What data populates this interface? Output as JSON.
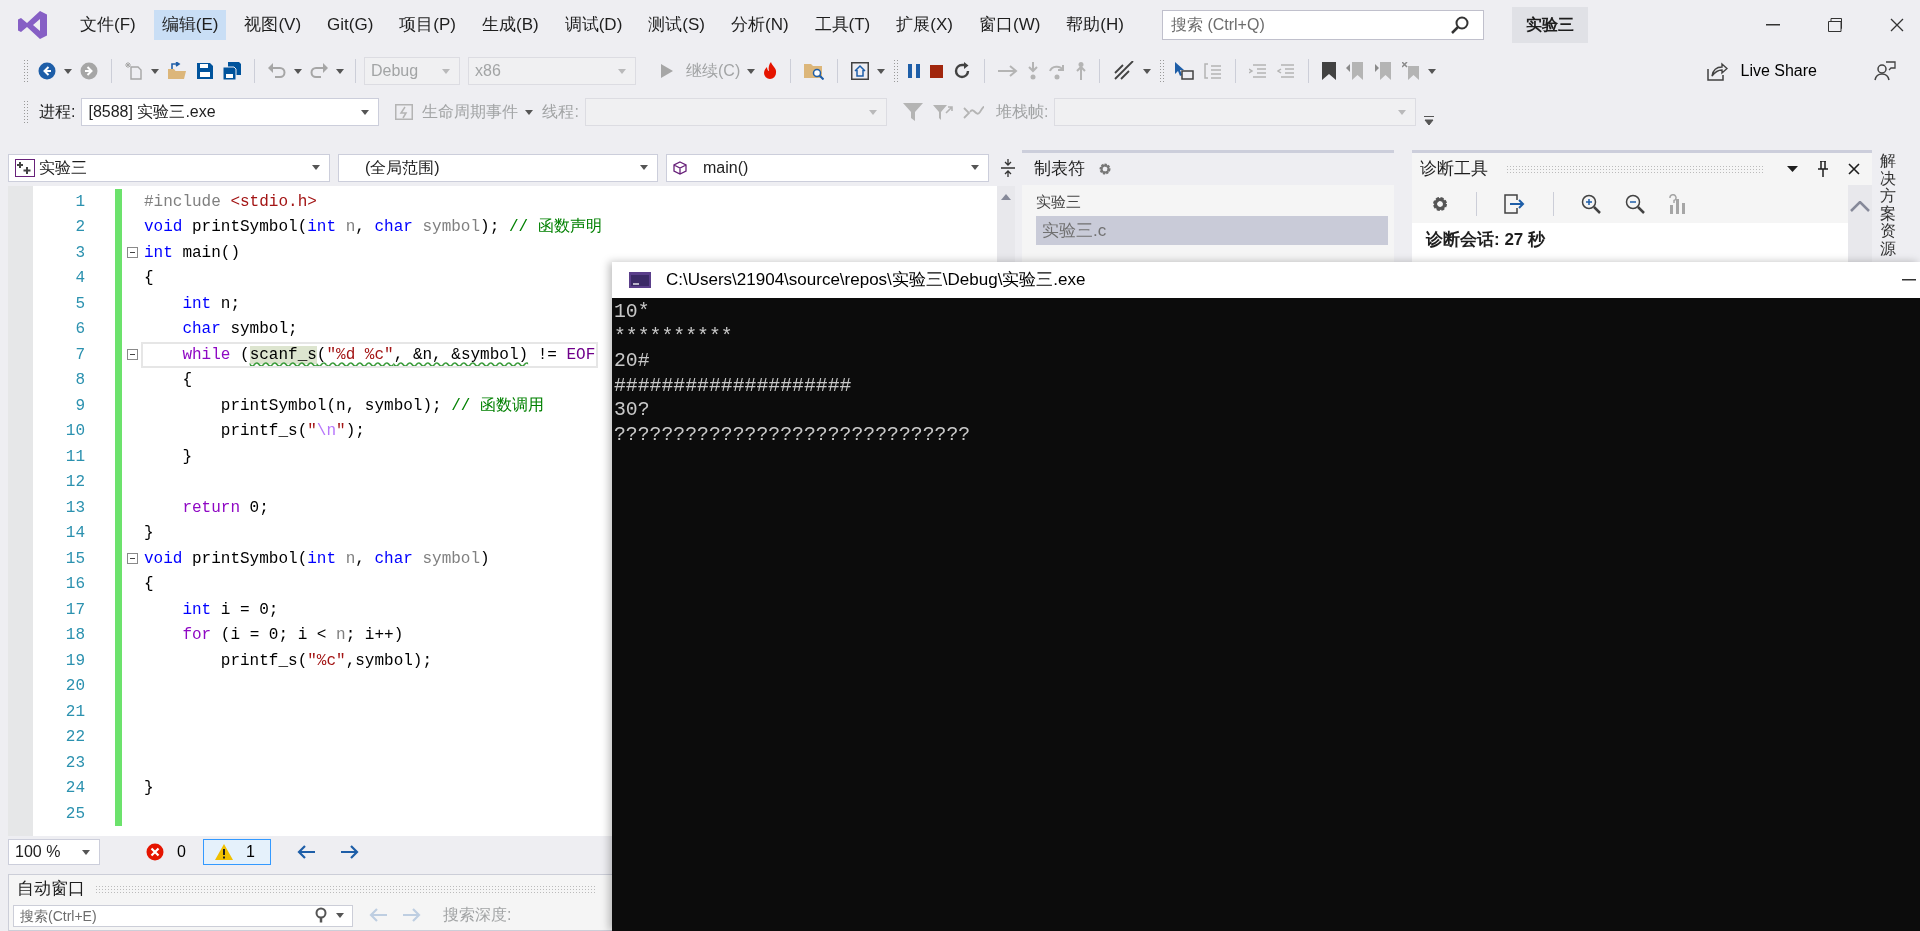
{
  "menu": [
    {
      "label": "文件(F)",
      "selected": false
    },
    {
      "label": "编辑(E)",
      "selected": true
    },
    {
      "label": "视图(V)",
      "selected": false
    },
    {
      "label": "Git(G)",
      "selected": false
    },
    {
      "label": "项目(P)",
      "selected": false
    },
    {
      "label": "生成(B)",
      "selected": false
    },
    {
      "label": "调试(D)",
      "selected": false
    },
    {
      "label": "测试(S)",
      "selected": false
    },
    {
      "label": "分析(N)",
      "selected": false
    },
    {
      "label": "工具(T)",
      "selected": false
    },
    {
      "label": "扩展(X)",
      "selected": false
    },
    {
      "label": "窗口(W)",
      "selected": false
    },
    {
      "label": "帮助(H)",
      "selected": false
    }
  ],
  "search": {
    "placeholder": "搜索 (Ctrl+Q)"
  },
  "solution_badge": "实验三",
  "toolbar": {
    "configuration": {
      "value": "Debug",
      "disabled": true
    },
    "platform": {
      "value": "x86",
      "disabled": true
    },
    "continue": {
      "label": "继续(C)",
      "disabled": true
    },
    "live_share": "Live Share"
  },
  "debug_location": {
    "process_label": "进程:",
    "process": "[8588] 实验三.exe",
    "lifecycle": {
      "label": "生命周期事件",
      "disabled": true
    },
    "thread_label": "线程:",
    "thread": {
      "disabled": true
    },
    "stack_label": "堆栈帧:",
    "stack": {
      "disabled": true
    }
  },
  "editor": {
    "nav": [
      "实验三",
      "(全局范围)",
      "main()"
    ],
    "lines": [
      {
        "num": "1",
        "changed": true,
        "fold": false,
        "current": false,
        "segs": [
          {
            "kind": "pre",
            "text": "#include"
          },
          {
            "kind": "str",
            "text": " <stdio.h>"
          }
        ]
      },
      {
        "num": "2",
        "changed": true,
        "fold": false,
        "current": false,
        "segs": [
          {
            "kind": "kw",
            "text": "void"
          },
          {
            "kind": "plain",
            "text": " printSymbol("
          },
          {
            "kind": "kw",
            "text": "int"
          },
          {
            "kind": "par",
            "text": " n"
          },
          {
            "kind": "plain",
            "text": ", "
          },
          {
            "kind": "kw",
            "text": "char"
          },
          {
            "kind": "par",
            "text": " symbol"
          },
          {
            "kind": "plain",
            "text": "); "
          },
          {
            "kind": "cmt",
            "text": "// 函数声明"
          }
        ]
      },
      {
        "num": "3",
        "changed": true,
        "fold": true,
        "current": false,
        "segs": [
          {
            "kind": "kw",
            "text": "int"
          },
          {
            "kind": "plain",
            "text": " main()"
          }
        ]
      },
      {
        "num": "4",
        "changed": true,
        "fold": false,
        "current": false,
        "segs": [
          {
            "kind": "plain",
            "text": "{"
          }
        ]
      },
      {
        "num": "5",
        "changed": true,
        "fold": false,
        "current": false,
        "segs": [
          {
            "kind": "kw",
            "text": "    int"
          },
          {
            "kind": "plain",
            "text": " n;"
          }
        ]
      },
      {
        "num": "6",
        "changed": true,
        "fold": false,
        "current": false,
        "segs": [
          {
            "kind": "kw",
            "text": "    char"
          },
          {
            "kind": "plain",
            "text": " symbol;"
          }
        ]
      },
      {
        "num": "7",
        "changed": true,
        "fold": true,
        "current": true,
        "segs": [
          {
            "kind": "ctl",
            "text": "    while"
          },
          {
            "kind": "plain",
            "text": " ("
          },
          {
            "kind": "warnref",
            "text": "scanf_s"
          },
          {
            "kind": "warnplain",
            "text": "("
          },
          {
            "kind": "warnstr",
            "text": "\"%d %c\""
          },
          {
            "kind": "warnplain",
            "text": ", &n, &symbol)"
          },
          {
            "kind": "plain",
            "text": " != "
          },
          {
            "kind": "mac",
            "text": "EOF"
          }
        ]
      },
      {
        "num": "8",
        "changed": true,
        "fold": false,
        "current": false,
        "segs": [
          {
            "kind": "plain",
            "text": "    {"
          }
        ]
      },
      {
        "num": "9",
        "changed": true,
        "fold": false,
        "current": false,
        "segs": [
          {
            "kind": "plain",
            "text": "        printSymbol(n, symbol); "
          },
          {
            "kind": "cmt",
            "text": "// 函数调用"
          }
        ]
      },
      {
        "num": "10",
        "changed": true,
        "fold": false,
        "current": false,
        "segs": [
          {
            "kind": "plain",
            "text": "        printf_s("
          },
          {
            "kind": "str",
            "text": "\""
          },
          {
            "kind": "esc",
            "text": "\\n"
          },
          {
            "kind": "str",
            "text": "\""
          },
          {
            "kind": "plain",
            "text": ");"
          }
        ]
      },
      {
        "num": "11",
        "changed": true,
        "fold": false,
        "current": false,
        "segs": [
          {
            "kind": "plain",
            "text": "    }"
          }
        ]
      },
      {
        "num": "12",
        "changed": true,
        "fold": false,
        "current": false
      },
      {
        "num": "13",
        "changed": true,
        "fold": false,
        "current": false,
        "segs": [
          {
            "kind": "ctl",
            "text": "    return"
          },
          {
            "kind": "plain",
            "text": " 0;"
          }
        ]
      },
      {
        "num": "14",
        "changed": true,
        "fold": false,
        "current": false,
        "segs": [
          {
            "kind": "plain",
            "text": "}"
          }
        ]
      },
      {
        "num": "15",
        "changed": true,
        "fold": true,
        "current": false,
        "segs": [
          {
            "kind": "kw",
            "text": "void"
          },
          {
            "kind": "plain",
            "text": " printSymbol("
          },
          {
            "kind": "kw",
            "text": "int"
          },
          {
            "kind": "par",
            "text": " n"
          },
          {
            "kind": "plain",
            "text": ", "
          },
          {
            "kind": "kw",
            "text": "char"
          },
          {
            "kind": "par",
            "text": " symbol"
          },
          {
            "kind": "plain",
            "text": ")"
          }
        ]
      },
      {
        "num": "16",
        "changed": true,
        "fold": false,
        "current": false,
        "segs": [
          {
            "kind": "plain",
            "text": "{"
          }
        ]
      },
      {
        "num": "17",
        "changed": true,
        "fold": false,
        "current": false,
        "segs": [
          {
            "kind": "kw",
            "text": "    int"
          },
          {
            "kind": "plain",
            "text": " i = 0;"
          }
        ]
      },
      {
        "num": "18",
        "changed": true,
        "fold": false,
        "current": false,
        "segs": [
          {
            "kind": "ctl",
            "text": "    for"
          },
          {
            "kind": "plain",
            "text": " (i = 0; i < "
          },
          {
            "kind": "par",
            "text": "n"
          },
          {
            "kind": "plain",
            "text": "; i++)"
          }
        ]
      },
      {
        "num": "19",
        "changed": true,
        "fold": false,
        "current": false,
        "segs": [
          {
            "kind": "plain",
            "text": "        printf_s("
          },
          {
            "kind": "str",
            "text": "\"%c\""
          },
          {
            "kind": "plain",
            "text": ",symbol);"
          }
        ]
      },
      {
        "num": "20",
        "changed": true,
        "fold": false,
        "current": false
      },
      {
        "num": "21",
        "changed": true,
        "fold": false,
        "current": false
      },
      {
        "num": "22",
        "changed": true,
        "fold": false,
        "current": false
      },
      {
        "num": "23",
        "changed": true,
        "fold": false,
        "current": false
      },
      {
        "num": "24",
        "changed": true,
        "fold": false,
        "current": false,
        "segs": [
          {
            "kind": "plain",
            "text": "}"
          }
        ]
      },
      {
        "num": "25",
        "changed": true,
        "fold": false,
        "current": false
      }
    ],
    "zoom": "100 %",
    "errors": "0",
    "warnings": "1",
    "warnings_selected": true
  },
  "tabs_panel": {
    "title": "制表符",
    "project": "实验三",
    "items": [
      {
        "label": "实验三.c",
        "selected": true
      }
    ]
  },
  "diagnostics": {
    "title": "诊断工具",
    "session": "诊断会话: 27 秒"
  },
  "side_tab": "解决方案资源",
  "autos": {
    "title": "自动窗口",
    "search_placeholder": "搜索(Ctrl+E)",
    "depth_label": "搜索深度:"
  },
  "console": {
    "title": "C:\\Users\\21904\\source\\repos\\实验三\\Debug\\实验三.exe",
    "lines": [
      "10*",
      "**********",
      "20#",
      "####################",
      "30?",
      "??????????????????????????????"
    ]
  }
}
